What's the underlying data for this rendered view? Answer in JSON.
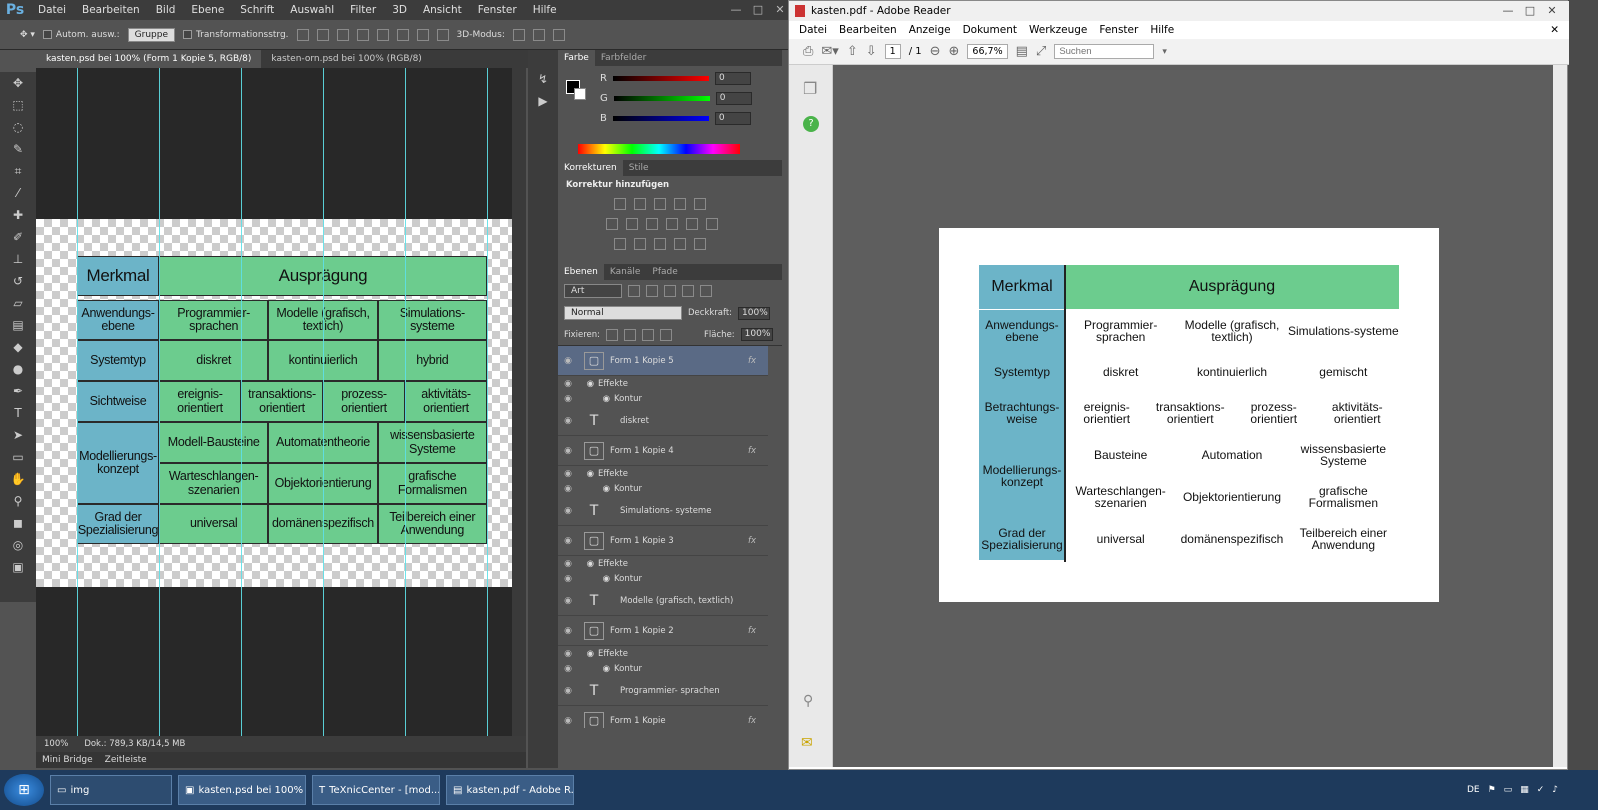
{
  "photoshop": {
    "logo": "Ps",
    "menu": [
      "Datei",
      "Bearbeiten",
      "Bild",
      "Ebene",
      "Schrift",
      "Auswahl",
      "Filter",
      "3D",
      "Ansicht",
      "Fenster",
      "Hilfe"
    ],
    "options": {
      "auto_select": "Autom. ausw.:",
      "group": "Gruppe",
      "transform": "Transformationsstrg.",
      "mode3d": "3D-Modus:"
    },
    "tabs": [
      "kasten.psd bei 100% (Form 1 Kopie 5, RGB/8)",
      "kasten-orn.psd bei 100% (RGB/8)"
    ],
    "table": {
      "header": [
        "Merkmal",
        "Ausprägung"
      ],
      "rows": [
        [
          "Anwendungs-ebene",
          "Programmier-sprachen",
          "Modelle (grafisch, textlich)",
          "Simulations-systeme"
        ],
        [
          "Systemtyp",
          "diskret",
          "kontinuierlich",
          "hybrid"
        ],
        [
          "Sichtweise",
          "ereignis-orientiert",
          "transaktions-orientiert",
          "prozess-orientiert",
          "aktivitäts-orientiert"
        ],
        [
          "Modellierungs-konzept",
          "Modell-Bausteine",
          "Automatentheorie",
          "wissensbasierte Systeme",
          "Warteschlangen-szenarien",
          "Objektorientierung",
          "grafische Formalismen"
        ],
        [
          "Grad der Spezialisierung",
          "universal",
          "domänenspezifisch",
          "Teilbereich einer Anwendung"
        ]
      ]
    },
    "status": {
      "zoom": "100%",
      "doc": "Dok.: 789,3 KB/14,5 MB"
    },
    "bottom_tabs": [
      "Mini Bridge",
      "Zeitleiste"
    ],
    "color_panel": {
      "tabs": [
        "Farbe",
        "Farbfelder"
      ],
      "r_label": "R",
      "g_label": "G",
      "b_label": "B",
      "r": "0",
      "g": "0",
      "b": "0"
    },
    "adjust_panel": {
      "tabs": [
        "Korrekturen",
        "Stile"
      ],
      "title": "Korrektur hinzufügen"
    },
    "layers_panel": {
      "tabs": [
        "Ebenen",
        "Kanäle",
        "Pfade"
      ],
      "filter": "Art",
      "blend": "Normal",
      "opacity_label": "Deckkraft:",
      "opacity": "100%",
      "lock_label": "Fixieren:",
      "fill_label": "Fläche:",
      "fill": "100%",
      "layers": [
        {
          "name": "Form 1 Kopie 5",
          "type": "shape",
          "selected": true,
          "fx": "fx"
        },
        {
          "name": "Effekte",
          "type": "sub"
        },
        {
          "name": "Kontur",
          "type": "sub2"
        },
        {
          "name": "diskret",
          "type": "text"
        },
        {
          "name": "Form 1 Kopie 4",
          "type": "shape",
          "fx": "fx"
        },
        {
          "name": "Effekte",
          "type": "sub"
        },
        {
          "name": "Kontur",
          "type": "sub2"
        },
        {
          "name": "Simulations- systeme",
          "type": "text"
        },
        {
          "name": "Form 1 Kopie 3",
          "type": "shape",
          "fx": "fx"
        },
        {
          "name": "Effekte",
          "type": "sub"
        },
        {
          "name": "Kontur",
          "type": "sub2"
        },
        {
          "name": "Modelle (grafisch, textlich)",
          "type": "text"
        },
        {
          "name": "Form 1 Kopie 2",
          "type": "shape",
          "fx": "fx"
        },
        {
          "name": "Effekte",
          "type": "sub"
        },
        {
          "name": "Kontur",
          "type": "sub2"
        },
        {
          "name": "Programmier- sprachen",
          "type": "text"
        },
        {
          "name": "Form 1 Kopie",
          "type": "shape",
          "fx": "fx"
        }
      ]
    }
  },
  "pdf": {
    "title": "kasten.pdf - Adobe Reader",
    "menu": [
      "Datei",
      "Bearbeiten",
      "Anzeige",
      "Dokument",
      "Werkzeuge",
      "Fenster",
      "Hilfe"
    ],
    "page": "1",
    "pages": "/ 1",
    "zoom": "66,7%",
    "search_placeholder": "Suchen",
    "table": {
      "header": [
        "Merkmal",
        "Ausprägung"
      ],
      "rows": [
        [
          "Anwendungs-ebene",
          "Programmier-sprachen",
          "Modelle (grafisch, textlich)",
          "Simulations-systeme"
        ],
        [
          "Systemtyp",
          "diskret",
          "kontinuierlich",
          "gemischt"
        ],
        [
          "Betrachtungs-weise",
          "ereignis-orientiert",
          "transaktions-orientiert",
          "prozess-orientiert",
          "aktivitäts-orientiert"
        ],
        [
          "Modellierungs-konzept",
          "Bausteine",
          "Automation",
          "wissensbasierte Systeme",
          "Warteschlangen-szenarien",
          "Objektorientierung",
          "grafische Formalismen"
        ],
        [
          "Grad der Spezialisierung",
          "universal",
          "domänenspezifisch",
          "Teilbereich einer Anwendung"
        ]
      ]
    }
  },
  "taskbar": {
    "items": [
      "img",
      "kasten.psd bei 100% ...",
      "TeXnicCenter - [mod...",
      "kasten.pdf - Adobe R..."
    ],
    "lang": "DE"
  }
}
